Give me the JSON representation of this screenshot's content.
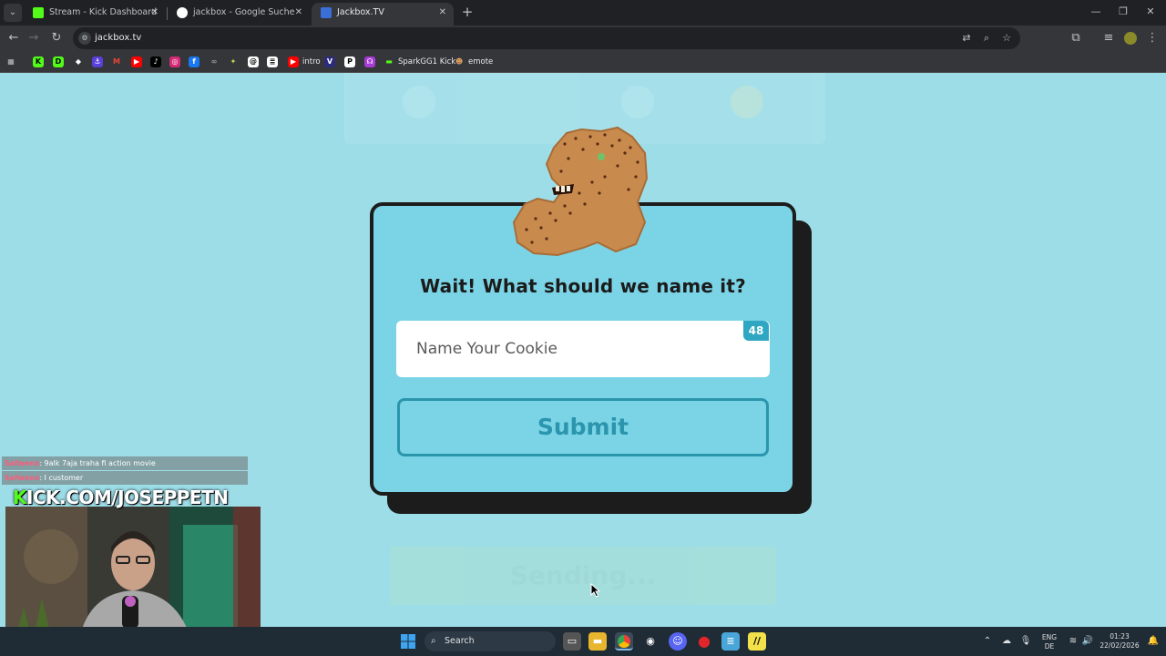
{
  "browser": {
    "tabs": [
      {
        "label": "Stream - Kick Dashboard",
        "active": false,
        "favicon_color": "#53fc18"
      },
      {
        "label": "jackbox - Google Suche",
        "active": false,
        "favicon_color": "#4285f4"
      },
      {
        "label": "Jackbox.TV",
        "active": true,
        "favicon_color": "#3a6fd8"
      }
    ],
    "url": "jackbox.tv",
    "bookmarks": [
      {
        "label": "",
        "icon": "kick-icon"
      },
      {
        "label": "",
        "icon": "dashboard-icon"
      },
      {
        "label": "",
        "icon": "diamond-icon"
      },
      {
        "label": "",
        "icon": "anchor-icon"
      },
      {
        "label": "",
        "icon": "gmail-icon"
      },
      {
        "label": "",
        "icon": "youtube-icon"
      },
      {
        "label": "",
        "icon": "tiktok-icon"
      },
      {
        "label": "",
        "icon": "instagram-icon"
      },
      {
        "label": "",
        "icon": "facebook-icon"
      },
      {
        "label": "",
        "icon": "link-icon"
      },
      {
        "label": "",
        "icon": "cursor-icon"
      },
      {
        "label": "",
        "icon": "threads-icon"
      },
      {
        "label": "",
        "icon": "doc-icon"
      },
      {
        "label": "intro",
        "icon": "youtube-icon"
      },
      {
        "label": "",
        "icon": "v-icon"
      },
      {
        "label": "",
        "icon": "p-icon"
      },
      {
        "label": "",
        "icon": "gamepad-icon"
      },
      {
        "label": "SparkGG1 Kick",
        "icon": "bar-icon"
      },
      {
        "label": "emote",
        "icon": "emote-icon"
      }
    ]
  },
  "game": {
    "question": "Wait! What should we name it?",
    "input_placeholder": "Name Your Cookie",
    "char_count": "48",
    "submit_label": "Submit",
    "sending_label": "Sending..."
  },
  "overlay": {
    "chat": [
      {
        "user": "Safwenx",
        "message": ": 9alk 7aja traha fi action movie"
      },
      {
        "user": "Safwenx",
        "message": ": I customer"
      }
    ],
    "kick_prefix": "K",
    "kick_url": "ICK.COM/JOSEPPETN"
  },
  "taskbar": {
    "search_label": "Search",
    "lang_top": "ENG",
    "lang_bottom": "DE",
    "time": "01:23",
    "date": "22/02/2026"
  }
}
